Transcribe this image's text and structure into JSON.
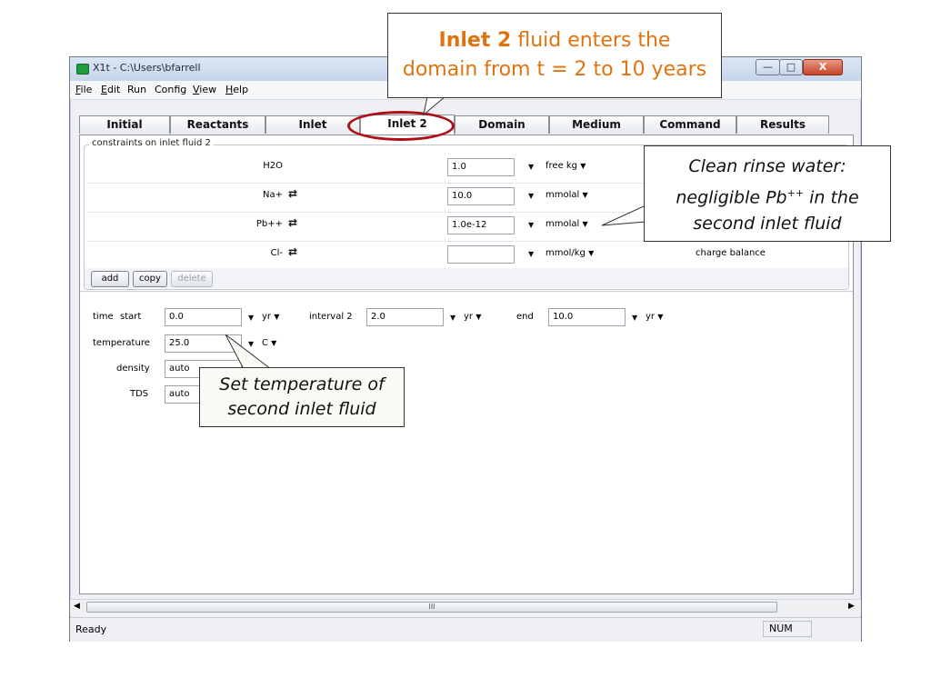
{
  "window": {
    "title": "X1t - C:\\Users\\bfarrell",
    "controls": {
      "minimize": "—",
      "maximize": "□",
      "close": "X"
    }
  },
  "menu": [
    {
      "label": "File",
      "mnemonic": "F"
    },
    {
      "label": "Edit",
      "mnemonic": "E"
    },
    {
      "label": "Run",
      "mnemonic": ""
    },
    {
      "label": "Config",
      "mnemonic": ""
    },
    {
      "label": "View",
      "mnemonic": "V"
    },
    {
      "label": "Help",
      "mnemonic": "H"
    }
  ],
  "tabs": [
    {
      "label": "Initial"
    },
    {
      "label": "Reactants"
    },
    {
      "label": "Inlet"
    },
    {
      "label": "Inlet 2",
      "active": true
    },
    {
      "label": "Domain"
    },
    {
      "label": "Medium"
    },
    {
      "label": "Command"
    },
    {
      "label": "Results"
    }
  ],
  "constraints": {
    "group_label": "constraints on inlet fluid 2",
    "rows": [
      {
        "species": "H2O",
        "swap": false,
        "value": "1.0",
        "unit": "free kg"
      },
      {
        "species": "Na+",
        "swap": true,
        "value": "10.0",
        "unit": "mmolal"
      },
      {
        "species": "Pb++",
        "swap": true,
        "value": "1.0e-12",
        "unit": "mmolal"
      },
      {
        "species": "Cl-",
        "swap": true,
        "value": "",
        "unit": "mmol/kg",
        "note": "charge balance"
      }
    ],
    "buttons": {
      "add": "add",
      "copy": "copy",
      "delete": "delete"
    }
  },
  "time": {
    "label": "time",
    "start_label": "start",
    "start_value": "0.0",
    "start_unit": "yr",
    "interval_label": "interval 2",
    "interval_value": "2.0",
    "interval_unit": "yr",
    "end_label": "end",
    "end_value": "10.0",
    "end_unit": "yr"
  },
  "temperature": {
    "label": "temperature",
    "value": "25.0",
    "unit": "C"
  },
  "density": {
    "label": "density",
    "value": "auto"
  },
  "tds": {
    "label": "TDS",
    "value": "auto"
  },
  "status": {
    "text": "Ready",
    "num": "NUM"
  },
  "scrollbar": {
    "grip": "III"
  },
  "callouts": {
    "top_bold": "Inlet 2",
    "top_line1_rest": " fluid enters the",
    "top_line2": "domain from t = 2 to 10 years",
    "right_line1": "Clean rinse water:",
    "right_line2_pre": "negligible Pb",
    "right_line2_sup": "++",
    "right_line2_post": " in the",
    "right_line3": "second inlet fluid",
    "bottom_line1": "Set temperature of",
    "bottom_line2": "second inlet fluid"
  },
  "colors": {
    "accent": "#e1730e",
    "highlight_ring": "#b00e17"
  }
}
